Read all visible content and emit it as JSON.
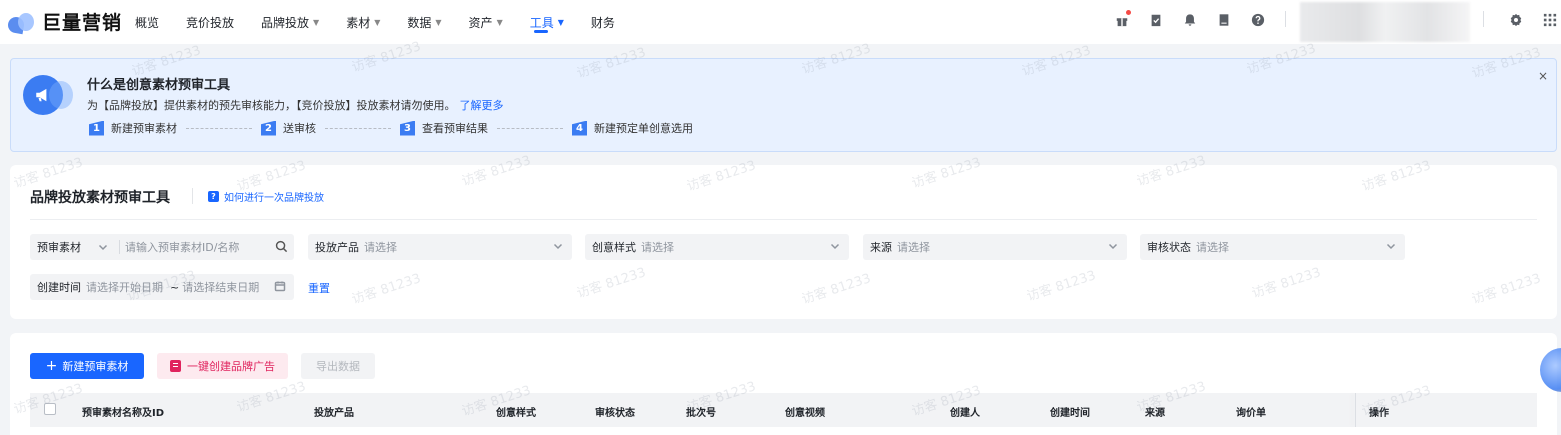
{
  "header": {
    "logo_text": "巨量营销",
    "nav": [
      {
        "label": "概览",
        "caret": false,
        "active": false
      },
      {
        "label": "竞价投放",
        "caret": false,
        "active": false
      },
      {
        "label": "品牌投放",
        "caret": true,
        "active": false
      },
      {
        "label": "素材",
        "caret": true,
        "active": false
      },
      {
        "label": "数据",
        "caret": true,
        "active": false
      },
      {
        "label": "资产",
        "caret": true,
        "active": false
      },
      {
        "label": "工具",
        "caret": true,
        "active": true
      },
      {
        "label": "财务",
        "caret": false,
        "active": false
      }
    ],
    "icons": [
      "gift-icon",
      "clipboard-icon",
      "bell-icon",
      "document-icon",
      "help-icon"
    ],
    "right_icons": [
      "settings-icon",
      "apps-grid-icon"
    ]
  },
  "watermark": "访客 81233",
  "banner": {
    "title": "什么是创意素材预审工具",
    "desc": "为【品牌投放】提供素材的预先审核能力，【竞价投放】投放素材请勿使用。",
    "learn_more": "了解更多",
    "close": "×",
    "steps": [
      {
        "num": "1",
        "label": "新建预审素材"
      },
      {
        "num": "2",
        "label": "送审核"
      },
      {
        "num": "3",
        "label": "查看预审结果"
      },
      {
        "num": "4",
        "label": "新建预定单创意选用"
      }
    ]
  },
  "filter": {
    "title": "品牌投放素材预审工具",
    "howto": "如何进行一次品牌投放",
    "search_type": "预审素材",
    "search_placeholder": "请输入预审素材ID/名称",
    "product_label": "投放产品",
    "product_placeholder": "请选择",
    "style_label": "创意样式",
    "style_placeholder": "请选择",
    "source_label": "来源",
    "source_placeholder": "请选择",
    "status_label": "审核状态",
    "status_placeholder": "请选择",
    "date_label": "创建时间",
    "date_start": "请选择开始日期",
    "date_sep": "~",
    "date_end": "请选择结束日期",
    "reset": "重置"
  },
  "toolbar": {
    "new_label": "新建预审素材",
    "brand_ad_label": "一键创建品牌广告",
    "export_label": "导出数据"
  },
  "table": {
    "columns": [
      "预审素材名称及ID",
      "投放产品",
      "创意样式",
      "审核状态",
      "批次号",
      "创意视频",
      "创建人",
      "创建时间",
      "来源",
      "询价单",
      "操作"
    ]
  }
}
